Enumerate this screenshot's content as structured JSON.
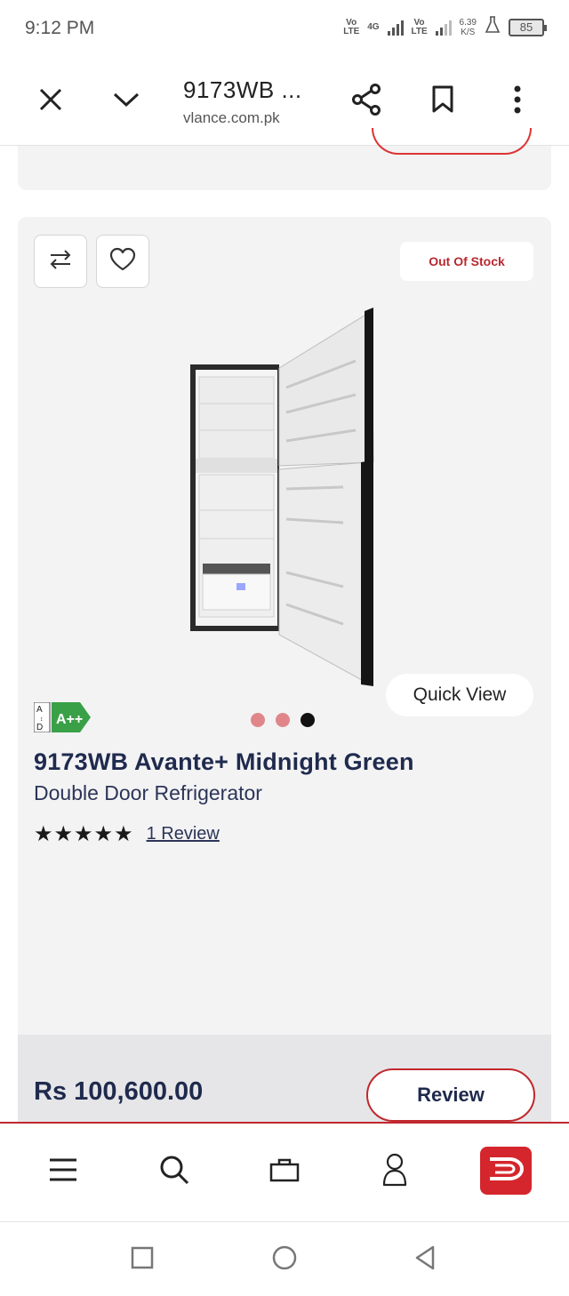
{
  "status": {
    "time": "9:12 PM",
    "net1": "Vo LTE",
    "net2": "4G",
    "net3": "Vo LTE",
    "speed_value": "6.39",
    "speed_unit": "K/S",
    "battery": "85"
  },
  "browser": {
    "title": "9173WB ...",
    "url": "vlance.com.pk"
  },
  "product": {
    "stock_status": "Out Of Stock",
    "quick_view_label": "Quick View",
    "energy_rating": "A++",
    "energy_scale_top": "A",
    "energy_scale_bottom": "D",
    "title": "9173WB Avante+ Midnight Green",
    "subtitle": "Double Door Refrigerator",
    "stars": "★★★★★",
    "rating": 5,
    "review_link": "1 Review",
    "price": "Rs 100,600.00",
    "review_button": "Review",
    "carousel_active_index": 2,
    "carousel_count": 3
  },
  "icons": {
    "close": "close-icon",
    "expand": "chevron-down-icon",
    "share": "share-icon",
    "bookmark": "bookmark-icon",
    "more": "more-vertical-icon",
    "compare": "compare-arrows-icon",
    "wishlist": "heart-icon",
    "menu": "menu-icon",
    "search": "search-icon",
    "bag": "bag-icon",
    "account": "user-icon",
    "brand": "brand-logo-icon"
  },
  "colors": {
    "accent_red": "#c0282e",
    "navy_text": "#1f2a4d",
    "card_bg": "#f3f3f4",
    "dot_inactive": "#e0868a",
    "dot_active": "#111111"
  }
}
